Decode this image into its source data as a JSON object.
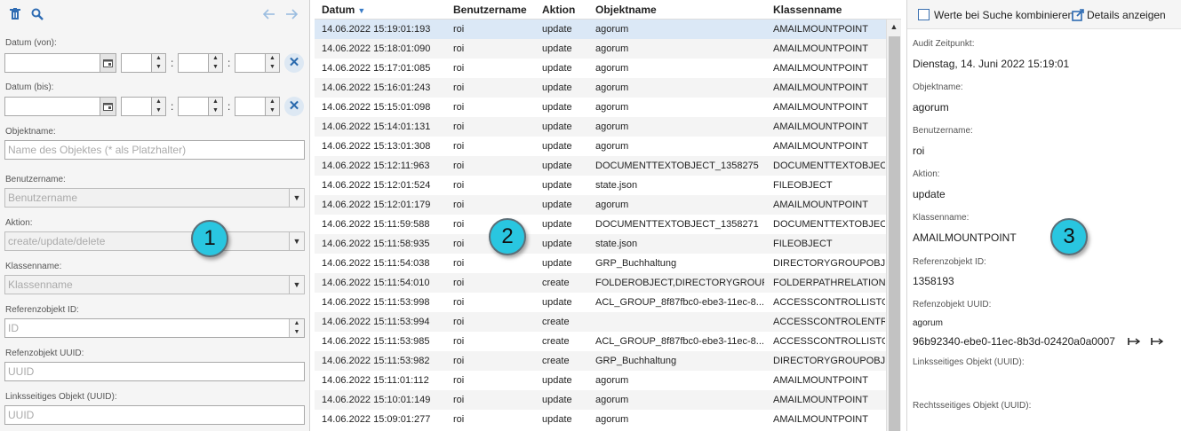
{
  "filter": {
    "date_from_label": "Datum (von):",
    "date_to_label": "Datum (bis):",
    "time_separator": ":",
    "clear_glyph": "✕",
    "objektname_label": "Objektname:",
    "objektname_placeholder": "Name des Objektes (* als Platzhalter)",
    "benutzername_label": "Benutzername:",
    "benutzername_placeholder": "Benutzername",
    "aktion_label": "Aktion:",
    "aktion_placeholder": "create/update/delete",
    "klassenname_label": "Klassenname:",
    "klassenname_placeholder": "Klassenname",
    "refid_label": "Referenzobjekt ID:",
    "refid_placeholder": "ID",
    "refuuid_label": "Refenzobjekt UUID:",
    "refuuid_placeholder": "UUID",
    "links_label": "Linksseitiges Objekt (UUID):",
    "links_placeholder": "UUID"
  },
  "table": {
    "columns": [
      "Datum",
      "Benutzername",
      "Aktion",
      "Objektname",
      "Klassenname"
    ],
    "sort_indicator": "▼",
    "rows": [
      [
        "14.06.2022 15:19:01:193",
        "roi",
        "update",
        "agorum",
        "AMAILMOUNTPOINT"
      ],
      [
        "14.06.2022 15:18:01:090",
        "roi",
        "update",
        "agorum",
        "AMAILMOUNTPOINT"
      ],
      [
        "14.06.2022 15:17:01:085",
        "roi",
        "update",
        "agorum",
        "AMAILMOUNTPOINT"
      ],
      [
        "14.06.2022 15:16:01:243",
        "roi",
        "update",
        "agorum",
        "AMAILMOUNTPOINT"
      ],
      [
        "14.06.2022 15:15:01:098",
        "roi",
        "update",
        "agorum",
        "AMAILMOUNTPOINT"
      ],
      [
        "14.06.2022 15:14:01:131",
        "roi",
        "update",
        "agorum",
        "AMAILMOUNTPOINT"
      ],
      [
        "14.06.2022 15:13:01:308",
        "roi",
        "update",
        "agorum",
        "AMAILMOUNTPOINT"
      ],
      [
        "14.06.2022 15:12:11:963",
        "roi",
        "update",
        "DOCUMENTTEXTOBJECT_1358275",
        "DOCUMENTTEXTOBJECT"
      ],
      [
        "14.06.2022 15:12:01:524",
        "roi",
        "update",
        "state.json",
        "FILEOBJECT"
      ],
      [
        "14.06.2022 15:12:01:179",
        "roi",
        "update",
        "agorum",
        "AMAILMOUNTPOINT"
      ],
      [
        "14.06.2022 15:11:59:588",
        "roi",
        "update",
        "DOCUMENTTEXTOBJECT_1358271",
        "DOCUMENTTEXTOBJECT"
      ],
      [
        "14.06.2022 15:11:58:935",
        "roi",
        "update",
        "state.json",
        "FILEOBJECT"
      ],
      [
        "14.06.2022 15:11:54:038",
        "roi",
        "update",
        "GRP_Buchhaltung",
        "DIRECTORYGROUPOBJECT"
      ],
      [
        "14.06.2022 15:11:54:010",
        "roi",
        "create",
        "FOLDEROBJECT,DIRECTORYGROUP...",
        "FOLDERPATHRELATIONOBJECT"
      ],
      [
        "14.06.2022 15:11:53:998",
        "roi",
        "update",
        "ACL_GROUP_8f87fbc0-ebe3-11ec-8...",
        "ACCESSCONTROLLISTOBJECT"
      ],
      [
        "14.06.2022 15:11:53:994",
        "roi",
        "create",
        "",
        "ACCESSCONTROLENTRYOBJECT"
      ],
      [
        "14.06.2022 15:11:53:985",
        "roi",
        "create",
        "ACL_GROUP_8f87fbc0-ebe3-11ec-8...",
        "ACCESSCONTROLLISTOBJECT"
      ],
      [
        "14.06.2022 15:11:53:982",
        "roi",
        "create",
        "GRP_Buchhaltung",
        "DIRECTORYGROUPOBJECT"
      ],
      [
        "14.06.2022 15:11:01:112",
        "roi",
        "update",
        "agorum",
        "AMAILMOUNTPOINT"
      ],
      [
        "14.06.2022 15:10:01:149",
        "roi",
        "update",
        "agorum",
        "AMAILMOUNTPOINT"
      ],
      [
        "14.06.2022 15:09:01:277",
        "roi",
        "update",
        "agorum",
        "AMAILMOUNTPOINT"
      ]
    ],
    "scroll_up": "▲"
  },
  "details": {
    "combine_label": "Werte bei Suche kombinieren",
    "details_label": "Details anzeigen",
    "audit_label": "Audit Zeitpunkt:",
    "audit_value": "Dienstag, 14. Juni 2022 15:19:01",
    "objektname_label": "Objektname:",
    "objektname_value": "agorum",
    "benutzername_label": "Benutzername:",
    "benutzername_value": "roi",
    "aktion_label": "Aktion:",
    "aktion_value": "update",
    "klassenname_label": "Klassenname:",
    "klassenname_value": "AMAILMOUNTPOINT",
    "refid_label": "Referenzobjekt ID:",
    "refid_value": "1358193",
    "refuuid_label": "Refenzobjekt UUID:",
    "refuuid_name": "agorum",
    "refuuid_value": "96b92340-ebe0-11ec-8b3d-02420a0a0007",
    "links_label": "Linksseitiges Objekt (UUID):",
    "rechts_label": "Rechtsseitiges Objekt (UUID):"
  },
  "markers": [
    "1",
    "2",
    "3"
  ],
  "colors": {
    "accent": "#3a7cc7",
    "selected_row": "#dbe8f6",
    "marker": "#29c6e0"
  }
}
